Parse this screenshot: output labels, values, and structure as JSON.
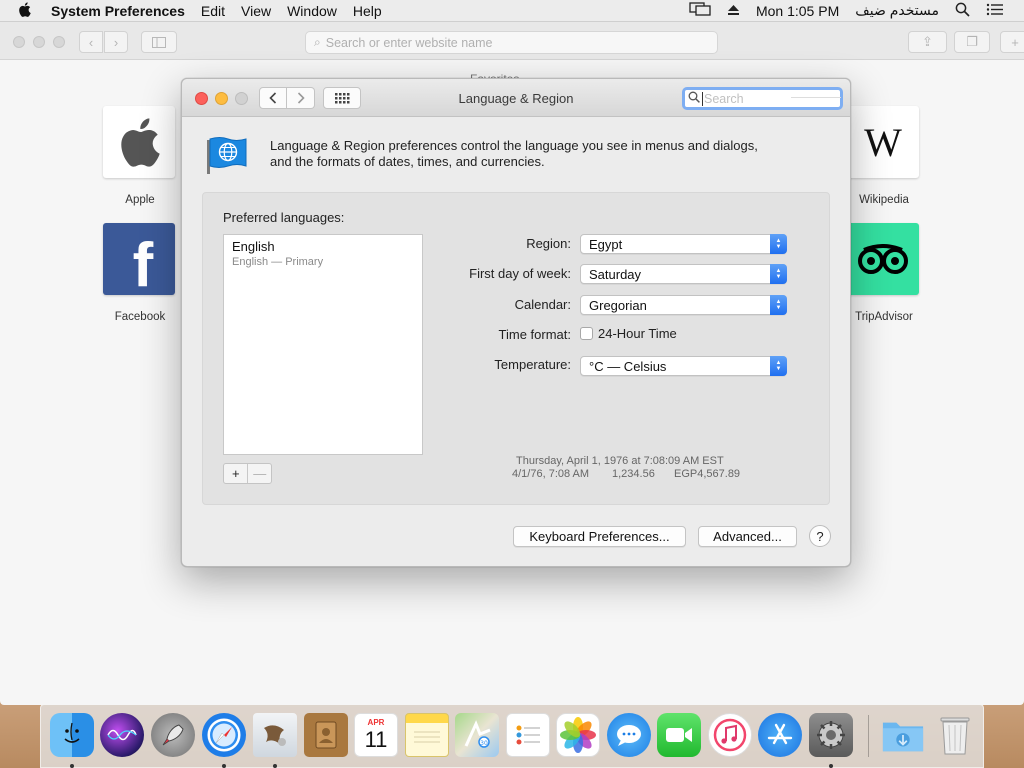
{
  "menubar": {
    "app_name": "System Preferences",
    "items": [
      "Edit",
      "View",
      "Window",
      "Help"
    ],
    "clock": "Mon 1:05 PM",
    "user": "مستخدم ضيف"
  },
  "safari": {
    "url_placeholder": "Search or enter website name",
    "section_title": "Favorites",
    "favorites": [
      "Apple",
      "Facebook",
      "Wikipedia",
      "TripAdvisor"
    ]
  },
  "prefs": {
    "title": "Language & Region",
    "search_placeholder": "Search",
    "intro_line1": "Language & Region preferences control the language you see in menus and dialogs,",
    "intro_line2": "and the formats of dates, times, and currencies.",
    "preferred_languages_label": "Preferred languages:",
    "languages": [
      {
        "name": "English",
        "detail": "English — Primary"
      }
    ],
    "add_symbol": "+",
    "remove_symbol": "—",
    "region_label": "Region:",
    "region_value": "Egypt",
    "first_day_label": "First day of week:",
    "first_day_value": "Saturday",
    "calendar_label": "Calendar:",
    "calendar_value": "Gregorian",
    "time_format_label": "Time format:",
    "time_format_option": "24-Hour Time",
    "time_format_checked": false,
    "temperature_label": "Temperature:",
    "temperature_value": "°C — Celsius",
    "sample_date_long": "Thursday, April 1, 1976 at 7:08:09 AM EST",
    "sample_date_short": "4/1/76, 7:08 AM",
    "sample_number": "1,234.56",
    "sample_currency": "EGP4,567.89",
    "keyboard_prefs_button": "Keyboard Preferences...",
    "advanced_button": "Advanced...",
    "help_symbol": "?"
  },
  "dock": {
    "apps": [
      "Finder",
      "Siri",
      "Launchpad",
      "Safari",
      "Mail",
      "Contacts",
      "Calendar",
      "Notes",
      "Maps",
      "Reminders",
      "Photos",
      "Messages",
      "FaceTime",
      "iTunes",
      "App Store",
      "System Preferences",
      "Downloads",
      "Trash"
    ],
    "calendar_month": "APR",
    "calendar_day": "11"
  }
}
